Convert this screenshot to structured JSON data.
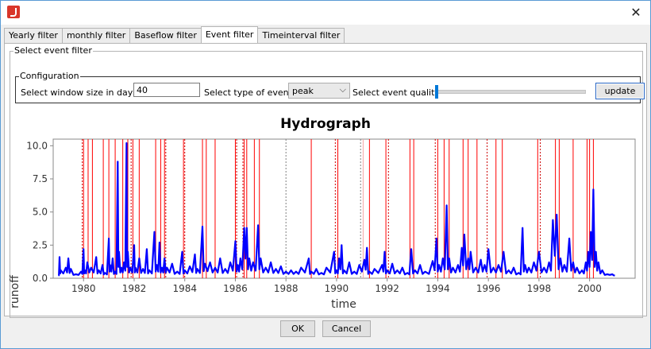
{
  "window": {
    "close_symbol": "✕"
  },
  "icons": {
    "app": "app-logo-icon",
    "close": "close-icon",
    "dropdown": "chevron-down-icon"
  },
  "tabs": [
    {
      "label": "Yearly filter"
    },
    {
      "label": "monthly filter"
    },
    {
      "label": "Baseflow filter"
    },
    {
      "label": "Event filter",
      "active": true
    },
    {
      "label": "Timeinterval filter"
    }
  ],
  "panel": {
    "group_title": "Select event filter",
    "config_title": "Configuration",
    "window_size_label": "Select window size in days",
    "window_size_value": "40",
    "event_type_label": "Select type of event",
    "event_type_value": "peak",
    "quality_label": "Select event quality",
    "quality_level": 0,
    "update_label": "update"
  },
  "chart_data": {
    "type": "line",
    "title": "Hydrograph",
    "xlabel": "time",
    "ylabel": "runoff",
    "xlim": [
      1978.8,
      2001.8
    ],
    "ylim": [
      0,
      10.5
    ],
    "xticks": [
      1980,
      1982,
      1984,
      1986,
      1988,
      1990,
      1992,
      1994,
      1996,
      1998,
      2000
    ],
    "xticklabels": [
      "1980",
      "1982",
      "1984",
      "1986",
      "1988",
      "1990",
      "1992",
      "1994",
      "1996",
      "1998",
      "2000"
    ],
    "yticks": [
      0,
      2.5,
      5.0,
      7.5,
      10.0
    ],
    "yticklabels": [
      "0.0",
      "2.5",
      "5.0",
      "7.5",
      "10.0"
    ],
    "grid": false,
    "colors": {
      "runoff": "#0000ff",
      "event": "#ff0000",
      "event_dashed": "#cc0000",
      "gray_dashed": "#808080"
    },
    "series": [
      {
        "values": [
          [
            1979.0,
            0.2
          ],
          [
            1979.05,
            1.6
          ],
          [
            1979.1,
            0.6
          ],
          [
            1979.3,
            0.8
          ],
          [
            1979.4,
            1.5
          ],
          [
            1979.5,
            0.7
          ],
          [
            1979.7,
            0.3
          ],
          [
            1979.9,
            0.5
          ],
          [
            1980.0,
            2.2
          ],
          [
            1980.05,
            0.6
          ],
          [
            1980.15,
            1.2
          ],
          [
            1980.3,
            0.8
          ],
          [
            1980.5,
            1.6
          ],
          [
            1980.6,
            0.6
          ],
          [
            1980.75,
            1.0
          ],
          [
            1980.85,
            0.4
          ],
          [
            1981.0,
            3.0
          ],
          [
            1981.05,
            1.0
          ],
          [
            1981.15,
            1.5
          ],
          [
            1981.25,
            0.5
          ],
          [
            1981.35,
            8.8
          ],
          [
            1981.4,
            2.0
          ],
          [
            1981.5,
            0.8
          ],
          [
            1981.6,
            1.2
          ],
          [
            1981.7,
            10.2
          ],
          [
            1981.75,
            2.0
          ],
          [
            1981.85,
            0.8
          ],
          [
            1982.0,
            2.5
          ],
          [
            1982.05,
            0.8
          ],
          [
            1982.2,
            1.5
          ],
          [
            1982.35,
            0.7
          ],
          [
            1982.5,
            2.2
          ],
          [
            1982.6,
            0.6
          ],
          [
            1982.8,
            3.5
          ],
          [
            1982.9,
            1.0
          ],
          [
            1983.0,
            2.7
          ],
          [
            1983.1,
            0.8
          ],
          [
            1983.2,
            1.5
          ],
          [
            1983.3,
            0.8
          ],
          [
            1983.5,
            1.1
          ],
          [
            1983.7,
            0.5
          ],
          [
            1983.9,
            2.0
          ],
          [
            1984.0,
            0.6
          ],
          [
            1984.2,
            0.9
          ],
          [
            1984.4,
            1.8
          ],
          [
            1984.5,
            0.7
          ],
          [
            1984.7,
            3.9
          ],
          [
            1984.8,
            1.1
          ],
          [
            1985.0,
            1.2
          ],
          [
            1985.2,
            0.8
          ],
          [
            1985.4,
            1.5
          ],
          [
            1985.6,
            0.7
          ],
          [
            1985.8,
            1.2
          ],
          [
            1986.0,
            2.8
          ],
          [
            1986.1,
            1.0
          ],
          [
            1986.2,
            1.5
          ],
          [
            1986.35,
            3.8
          ],
          [
            1986.45,
            3.8
          ],
          [
            1986.55,
            1.5
          ],
          [
            1986.7,
            1.2
          ],
          [
            1986.9,
            4.0
          ],
          [
            1987.0,
            1.5
          ],
          [
            1987.2,
            0.8
          ],
          [
            1987.4,
            1.2
          ],
          [
            1987.6,
            0.7
          ],
          [
            1987.8,
            0.9
          ],
          [
            1988.0,
            0.5
          ],
          [
            1988.2,
            0.6
          ],
          [
            1988.4,
            0.5
          ],
          [
            1988.6,
            0.8
          ],
          [
            1988.9,
            1.5
          ],
          [
            1989.0,
            0.5
          ],
          [
            1989.2,
            0.7
          ],
          [
            1989.4,
            0.4
          ],
          [
            1989.6,
            0.8
          ],
          [
            1989.9,
            2.0
          ],
          [
            1990.0,
            0.6
          ],
          [
            1990.1,
            1.5
          ],
          [
            1990.2,
            2.5
          ],
          [
            1990.3,
            0.6
          ],
          [
            1990.5,
            1.2
          ],
          [
            1990.7,
            0.5
          ],
          [
            1990.9,
            1.0
          ],
          [
            1991.1,
            1.4
          ],
          [
            1991.2,
            2.3
          ],
          [
            1991.3,
            0.5
          ],
          [
            1991.5,
            0.7
          ],
          [
            1991.8,
            1.0
          ],
          [
            1991.9,
            2.0
          ],
          [
            1992.0,
            0.6
          ],
          [
            1992.2,
            1.1
          ],
          [
            1992.4,
            0.6
          ],
          [
            1992.6,
            0.8
          ],
          [
            1992.8,
            0.4
          ],
          [
            1992.95,
            2.2
          ],
          [
            1993.1,
            0.6
          ],
          [
            1993.3,
            1.0
          ],
          [
            1993.5,
            0.5
          ],
          [
            1993.8,
            1.3
          ],
          [
            1993.95,
            3.0
          ],
          [
            1994.05,
            1.0
          ],
          [
            1994.2,
            1.5
          ],
          [
            1994.35,
            5.5
          ],
          [
            1994.45,
            1.5
          ],
          [
            1994.6,
            0.8
          ],
          [
            1994.8,
            1.0
          ],
          [
            1994.95,
            2.3
          ],
          [
            1995.05,
            3.3
          ],
          [
            1995.2,
            1.5
          ],
          [
            1995.3,
            2.0
          ],
          [
            1995.5,
            0.8
          ],
          [
            1995.7,
            1.4
          ],
          [
            1995.85,
            1.0
          ],
          [
            1996.0,
            2.2
          ],
          [
            1996.2,
            0.8
          ],
          [
            1996.4,
            1.0
          ],
          [
            1996.6,
            2.0
          ],
          [
            1996.8,
            0.6
          ],
          [
            1997.0,
            0.8
          ],
          [
            1997.2,
            0.4
          ],
          [
            1997.35,
            3.8
          ],
          [
            1997.45,
            1.0
          ],
          [
            1997.6,
            0.8
          ],
          [
            1997.8,
            1.2
          ],
          [
            1998.0,
            2.0
          ],
          [
            1998.2,
            0.8
          ],
          [
            1998.4,
            1.2
          ],
          [
            1998.55,
            4.4
          ],
          [
            1998.7,
            4.8
          ],
          [
            1998.85,
            1.5
          ],
          [
            1999.0,
            1.0
          ],
          [
            1999.2,
            3.0
          ],
          [
            1999.35,
            1.2
          ],
          [
            1999.5,
            0.8
          ],
          [
            1999.7,
            0.6
          ],
          [
            1999.85,
            1.2
          ],
          [
            1999.95,
            2.0
          ],
          [
            2000.05,
            3.5
          ],
          [
            2000.15,
            6.7
          ],
          [
            2000.25,
            2.0
          ],
          [
            2000.35,
            1.2
          ],
          [
            2000.5,
            0.6
          ],
          [
            2000.7,
            0.3
          ],
          [
            2000.9,
            0.3
          ],
          [
            2001.0,
            0.2
          ]
        ]
      }
    ],
    "events_solid": [
      1980.0,
      1980.18,
      1980.35,
      1980.78,
      1981.0,
      1981.25,
      1981.55,
      1981.75,
      1981.95,
      1982.2,
      1982.85,
      1983.05,
      1983.2,
      1983.95,
      1984.7,
      1984.85,
      1985.2,
      1986.0,
      1986.35,
      1986.45,
      1986.75,
      1986.95,
      1989.0,
      1990.05,
      1991.3,
      1991.95,
      1992.9,
      1993.05,
      1994.0,
      1994.25,
      1994.45,
      1995.0,
      1995.2,
      1995.55,
      1996.3,
      1996.55,
      1997.95,
      1998.65,
      1998.8,
      1999.35,
      1999.9,
      2000.0,
      2000.15
    ],
    "events_dashed": [
      1979.95,
      1981.88,
      1983.25,
      1984.0,
      1986.05,
      1986.3,
      1989.95,
      1992.05,
      1993.9,
      1995.95,
      1998.05
    ],
    "events_gray_dashed": [
      1988.0,
      1990.95
    ],
    "events_pink": [
      1991.05
    ]
  },
  "footer": {
    "ok_label": "OK",
    "cancel_label": "Cancel"
  }
}
